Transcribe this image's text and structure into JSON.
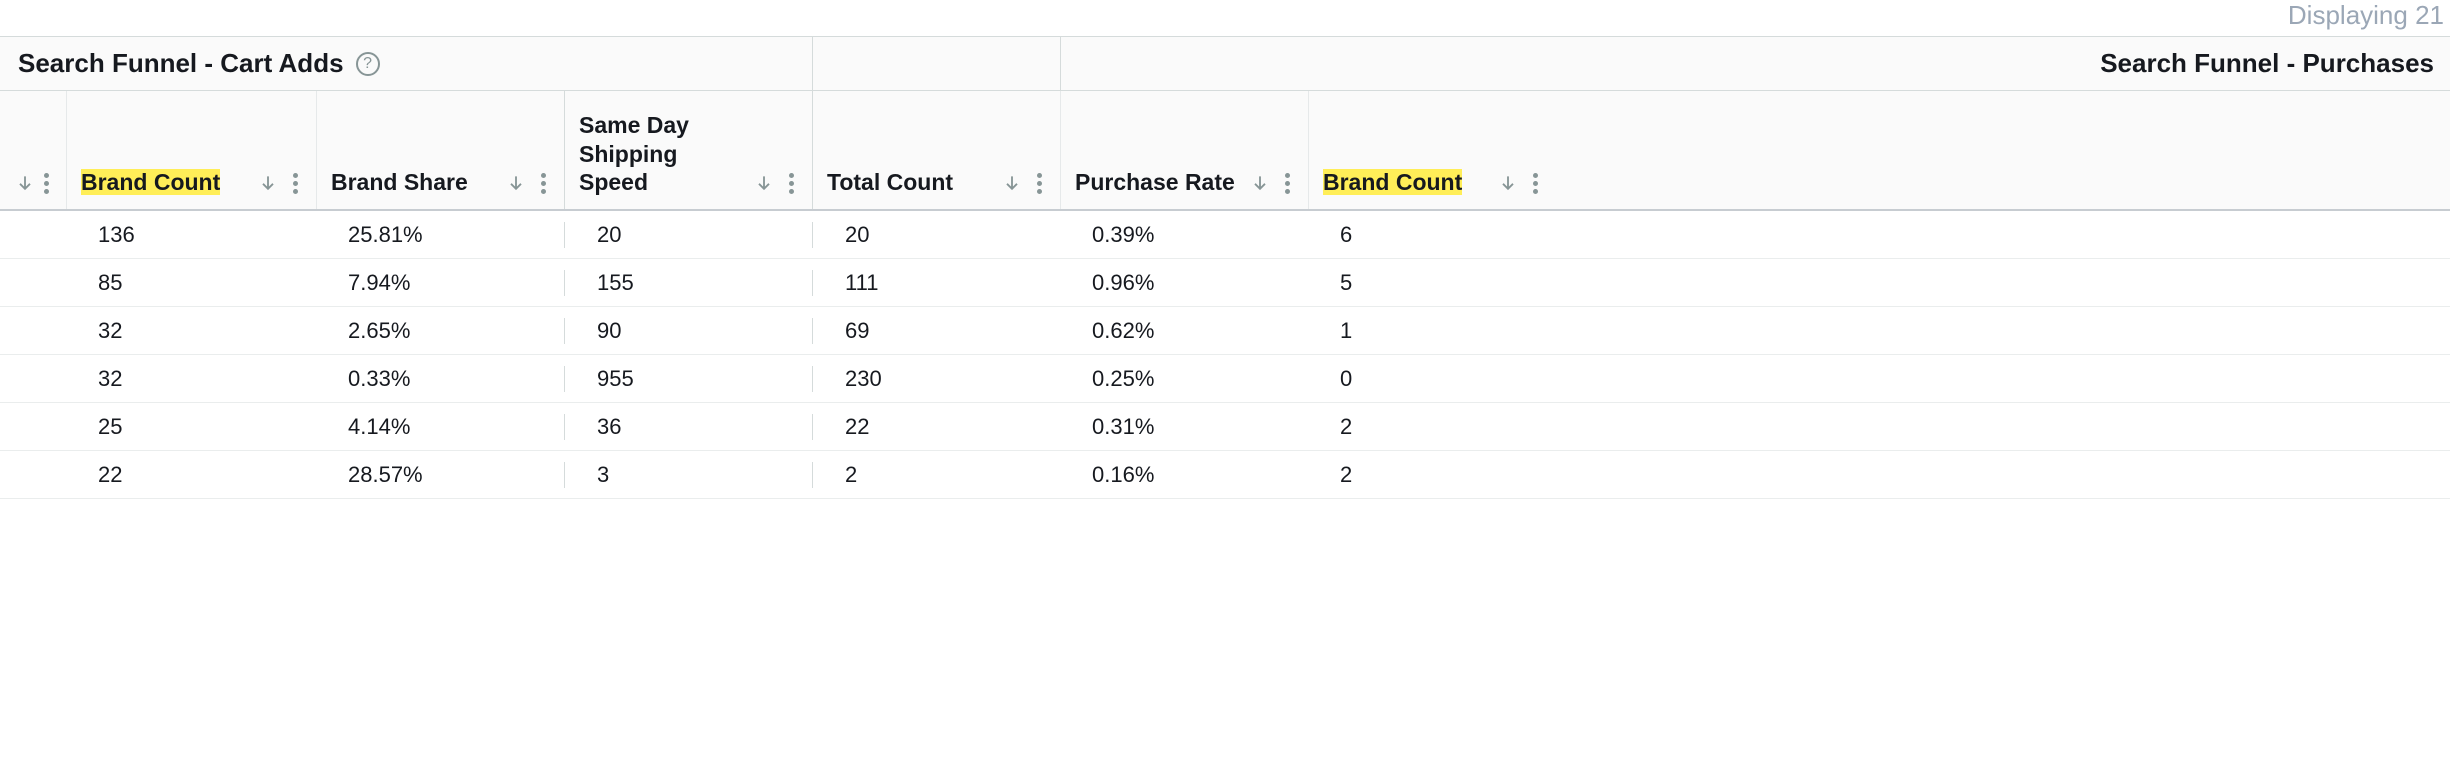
{
  "top_status": "Displaying 21",
  "groups": {
    "cart_adds": "Search Funnel - Cart Adds",
    "purchases": "Search Funnel - Purchases"
  },
  "columns": {
    "c0": "",
    "c1": "Brand Count",
    "c2": "Brand Share",
    "c3": "Same Day Shipping Speed",
    "c4": "Total Count",
    "c5": "Purchase Rate",
    "c6": "Brand Count"
  },
  "highlight": {
    "c1": true,
    "c6": true
  },
  "rows": [
    {
      "c1": "136",
      "c2": "25.81%",
      "c3": "20",
      "c4": "20",
      "c5": "0.39%",
      "c6": "6"
    },
    {
      "c1": "85",
      "c2": "7.94%",
      "c3": "155",
      "c4": "111",
      "c5": "0.96%",
      "c6": "5"
    },
    {
      "c1": "32",
      "c2": "2.65%",
      "c3": "90",
      "c4": "69",
      "c5": "0.62%",
      "c6": "1"
    },
    {
      "c1": "32",
      "c2": "0.33%",
      "c3": "955",
      "c4": "230",
      "c5": "0.25%",
      "c6": "0"
    },
    {
      "c1": "25",
      "c2": "4.14%",
      "c3": "36",
      "c4": "22",
      "c5": "0.31%",
      "c6": "2"
    },
    {
      "c1": "22",
      "c2": "28.57%",
      "c3": "3",
      "c4": "2",
      "c5": "0.16%",
      "c6": "2"
    }
  ]
}
